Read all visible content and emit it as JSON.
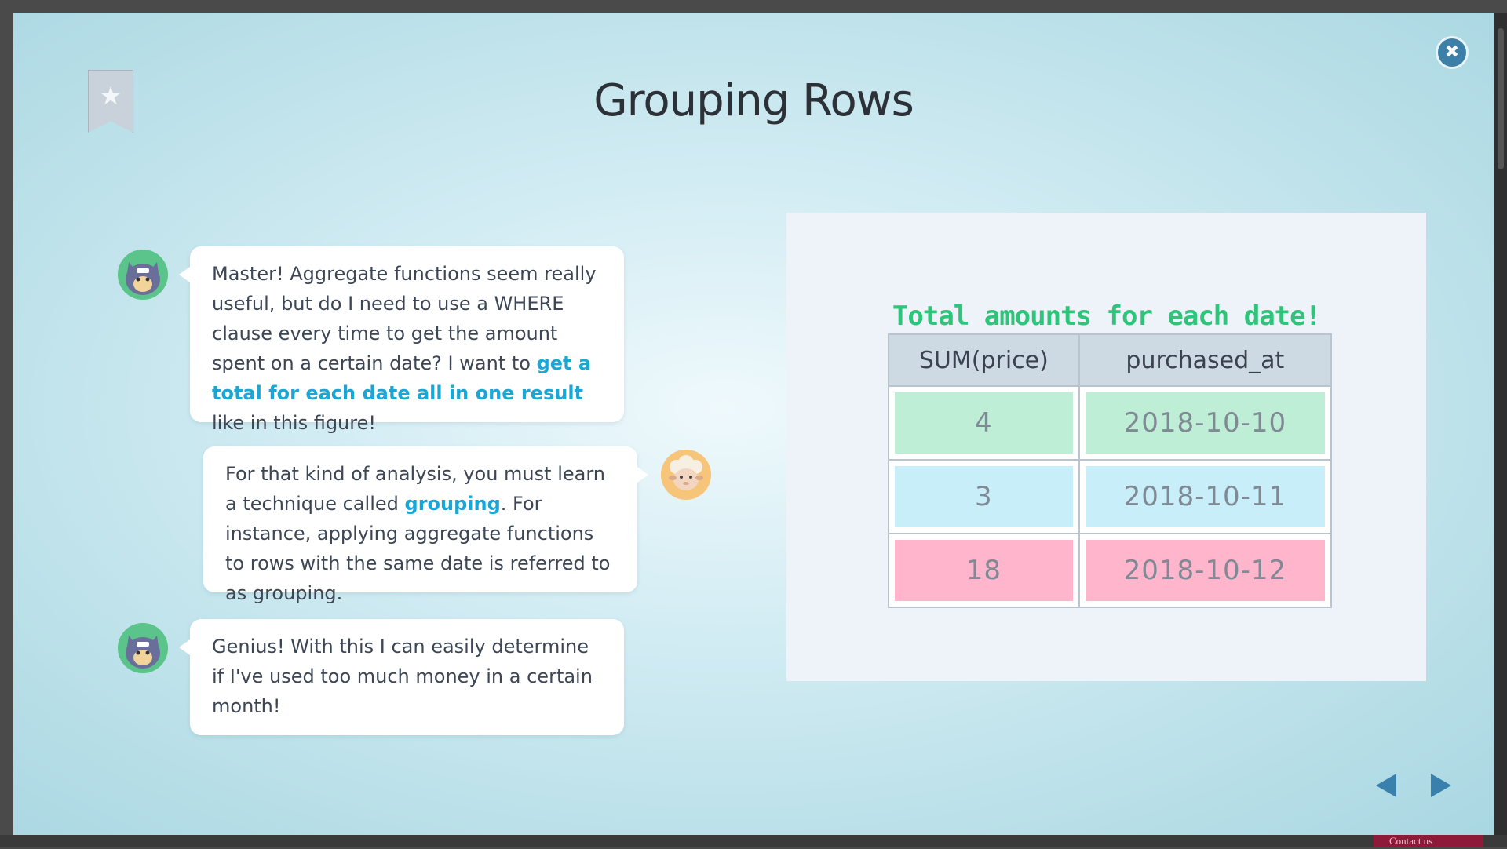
{
  "page": {
    "title": "Grouping Rows",
    "close_label": "✖",
    "bookmark_icon": "star-icon",
    "contact_label": "Contact us"
  },
  "conversation": [
    {
      "speaker": "cat",
      "side": "left",
      "parts": [
        {
          "text": "Master! Aggregate functions seem really useful, but do I need to use a WHERE clause every time to get the amount spent on a certain date? I want to ",
          "highlight": false
        },
        {
          "text": "get a total for each date all in one result",
          "highlight": true
        },
        {
          "text": " like in this figure!",
          "highlight": false
        }
      ]
    },
    {
      "speaker": "sheep",
      "side": "right",
      "parts": [
        {
          "text": "For that kind of analysis, you must learn a technique called ",
          "highlight": false
        },
        {
          "text": "grouping",
          "highlight": true
        },
        {
          "text": ". For instance, applying aggregate functions to rows with the same date is referred to as grouping.",
          "highlight": false
        }
      ]
    },
    {
      "speaker": "cat",
      "side": "left",
      "parts": [
        {
          "text": "Genius! With this I can easily determine if I've used too much money in a certain month!",
          "highlight": false
        }
      ]
    }
  ],
  "figure": {
    "title": "Total amounts for each date!",
    "headers": [
      "SUM(price)",
      "purchased_at"
    ],
    "rows": [
      {
        "sum": "4",
        "date": "2018-10-10",
        "color": "#bfeed6"
      },
      {
        "sum": "3",
        "date": "2018-10-11",
        "color": "#c7eef9"
      },
      {
        "sum": "18",
        "date": "2018-10-12",
        "color": "#ffb6cd"
      }
    ]
  },
  "navigation": {
    "prev_icon": "arrow-left-icon",
    "next_icon": "arrow-right-icon"
  },
  "colors": {
    "accent": "#1ca6d6",
    "figure_title": "#2ec47a",
    "nav": "#3a80ad"
  }
}
